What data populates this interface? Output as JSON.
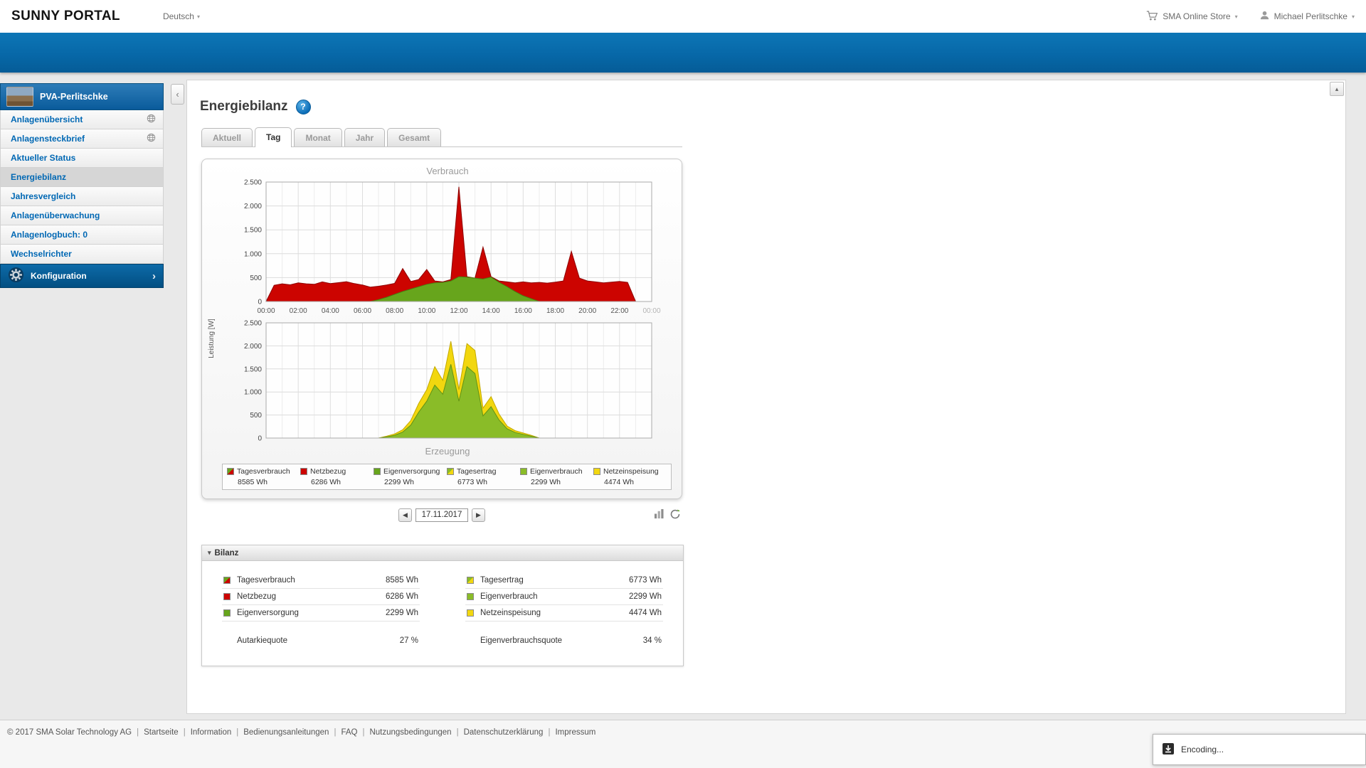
{
  "header": {
    "logo": "SUNNY PORTAL",
    "language": "Deutsch",
    "store": "SMA Online Store",
    "user": "Michael Perlitschke"
  },
  "sidebar": {
    "plant": "PVA-Perlitschke",
    "items": [
      {
        "label": "Anlagenübersicht",
        "icon": "globe"
      },
      {
        "label": "Anlagensteckbrief",
        "icon": "globe"
      },
      {
        "label": "Aktueller Status"
      },
      {
        "label": "Energiebilanz",
        "active": true
      },
      {
        "label": "Jahresvergleich"
      },
      {
        "label": "Anlagenüberwachung"
      },
      {
        "label": "Anlagenlogbuch: 0"
      },
      {
        "label": "Wechselrichter"
      }
    ],
    "konfiguration": "Konfiguration"
  },
  "main": {
    "title": "Energiebilanz",
    "tabs": [
      {
        "label": "Aktuell"
      },
      {
        "label": "Tag",
        "active": true
      },
      {
        "label": "Monat"
      },
      {
        "label": "Jahr"
      },
      {
        "label": "Gesamt"
      }
    ],
    "date": "17.11.2017",
    "bilanz": {
      "title": "Bilanz",
      "left": [
        {
          "label": "Tagesverbrauch",
          "value": "8585 Wh",
          "colors": [
            "#67a51c",
            "#cc0400"
          ]
        },
        {
          "label": "Netzbezug",
          "value": "6286 Wh",
          "colors": [
            "#cc0400"
          ]
        },
        {
          "label": "Eigenversorgung",
          "value": "2299 Wh",
          "colors": [
            "#67a51c"
          ]
        },
        {
          "label": "Autarkiequote",
          "value": "27 %"
        }
      ],
      "right": [
        {
          "label": "Tagesertrag",
          "value": "6773 Wh",
          "colors": [
            "#8abc28",
            "#f2d70f"
          ]
        },
        {
          "label": "Eigenverbrauch",
          "value": "2299 Wh",
          "colors": [
            "#8abc28"
          ]
        },
        {
          "label": "Netzeinspeisung",
          "value": "4474 Wh",
          "colors": [
            "#f2d70f"
          ]
        },
        {
          "label": "Eigenverbrauchsquote",
          "value": "34 %"
        }
      ]
    }
  },
  "legend": [
    {
      "label": "Tagesverbrauch",
      "value": "8585 Wh",
      "colors": [
        "#67a51c",
        "#cc0400"
      ]
    },
    {
      "label": "Netzbezug",
      "value": "6286 Wh",
      "colors": [
        "#cc0400"
      ]
    },
    {
      "label": "Eigenversorgung",
      "value": "2299 Wh",
      "colors": [
        "#67a51c"
      ]
    },
    {
      "label": "Tagesertrag",
      "value": "6773 Wh",
      "colors": [
        "#8abc28",
        "#f2d70f"
      ]
    },
    {
      "label": "Eigenverbrauch",
      "value": "2299 Wh",
      "colors": [
        "#8abc28"
      ]
    },
    {
      "label": "Netzeinspeisung",
      "value": "4474 Wh",
      "colors": [
        "#f2d70f"
      ]
    }
  ],
  "chart_data": [
    {
      "type": "area",
      "title": "Verbrauch",
      "ylabel": "Leistung [W]",
      "ylim": [
        0,
        2500
      ],
      "yticks": [
        "0",
        "500",
        "1.000",
        "1.500",
        "2.000",
        "2.500"
      ],
      "xticks": [
        "00:00",
        "02:00",
        "04:00",
        "06:00",
        "08:00",
        "10:00",
        "12:00",
        "14:00",
        "16:00",
        "18:00",
        "20:00",
        "22:00",
        "00:00"
      ],
      "x": [
        0,
        0.5,
        1,
        1.5,
        2,
        2.5,
        3,
        3.5,
        4,
        4.5,
        5,
        5.5,
        6,
        6.5,
        7,
        7.5,
        8,
        8.5,
        9,
        9.5,
        10,
        10.5,
        11,
        11.5,
        12,
        12.5,
        13,
        13.5,
        14,
        14.5,
        15,
        15.5,
        16,
        16.5,
        17,
        17.5,
        18,
        18.5,
        19,
        19.5,
        20,
        20.5,
        21,
        21.5,
        22,
        22.5,
        23,
        23.5,
        24
      ],
      "series": [
        {
          "name": "Tagesverbrauch",
          "color": "#cc0400",
          "stroke": "#8e0300",
          "values": [
            0,
            340,
            370,
            350,
            390,
            370,
            360,
            410,
            375,
            395,
            415,
            375,
            345,
            300,
            320,
            345,
            380,
            690,
            420,
            460,
            670,
            430,
            410,
            460,
            2400,
            520,
            490,
            1140,
            520,
            430,
            410,
            390,
            410,
            390,
            400,
            385,
            405,
            430,
            1050,
            490,
            430,
            410,
            390,
            405,
            420,
            400,
            0,
            0,
            0
          ]
        },
        {
          "name": "Eigenversorgung",
          "color": "#67a51c",
          "stroke": "#4a7d10",
          "values": [
            0,
            0,
            0,
            0,
            0,
            0,
            0,
            0,
            0,
            0,
            0,
            0,
            0,
            0,
            40,
            90,
            150,
            210,
            260,
            310,
            360,
            390,
            400,
            430,
            520,
            510,
            490,
            470,
            510,
            400,
            310,
            210,
            120,
            60,
            0,
            0,
            0,
            0,
            0,
            0,
            0,
            0,
            0,
            0,
            0,
            0,
            0,
            0,
            0
          ]
        }
      ]
    },
    {
      "type": "area",
      "title": "Erzeugung",
      "ylabel": "Leistung [W]",
      "ylim": [
        0,
        2500
      ],
      "yticks": [
        "0",
        "500",
        "1.000",
        "1.500",
        "2.000",
        "2.500"
      ],
      "xticks": [
        "00:00",
        "02:00",
        "04:00",
        "06:00",
        "08:00",
        "10:00",
        "12:00",
        "14:00",
        "16:00",
        "18:00",
        "20:00",
        "22:00",
        "00:00"
      ],
      "x": [
        0,
        0.5,
        1,
        1.5,
        2,
        2.5,
        3,
        3.5,
        4,
        4.5,
        5,
        5.5,
        6,
        6.5,
        7,
        7.5,
        8,
        8.5,
        9,
        9.5,
        10,
        10.5,
        11,
        11.5,
        12,
        12.5,
        13,
        13.5,
        14,
        14.5,
        15,
        15.5,
        16,
        16.5,
        17,
        17.5,
        18,
        18.5,
        19,
        19.5,
        20,
        20.5,
        21,
        21.5,
        22,
        22.5,
        23,
        23.5,
        24
      ],
      "series": [
        {
          "name": "Tagesertrag",
          "color": "#f2d70f",
          "stroke": "#c3a900",
          "values": [
            0,
            0,
            0,
            0,
            0,
            0,
            0,
            0,
            0,
            0,
            0,
            0,
            0,
            0,
            0,
            40,
            90,
            180,
            380,
            750,
            1050,
            1550,
            1250,
            2100,
            1050,
            2050,
            1900,
            650,
            900,
            520,
            260,
            160,
            110,
            60,
            0,
            0,
            0,
            0,
            0,
            0,
            0,
            0,
            0,
            0,
            0,
            0,
            0,
            0,
            0
          ]
        },
        {
          "name": "Eigenverbrauch",
          "color": "#8abc28",
          "stroke": "#639213",
          "values": [
            0,
            0,
            0,
            0,
            0,
            0,
            0,
            0,
            0,
            0,
            0,
            0,
            0,
            0,
            0,
            25,
            60,
            130,
            280,
            560,
            800,
            1150,
            950,
            1600,
            800,
            1550,
            1400,
            480,
            680,
            390,
            200,
            120,
            80,
            40,
            0,
            0,
            0,
            0,
            0,
            0,
            0,
            0,
            0,
            0,
            0,
            0,
            0,
            0,
            0
          ]
        }
      ]
    }
  ],
  "footer": {
    "copyright": "© 2017 SMA Solar Technology AG",
    "links": [
      "Startseite",
      "Information",
      "Bedienungsanleitungen",
      "FAQ",
      "Nutzungsbedingungen",
      "Datenschutzerklärung",
      "Impressum"
    ]
  },
  "encoding_popup": {
    "label": "Encoding..."
  }
}
